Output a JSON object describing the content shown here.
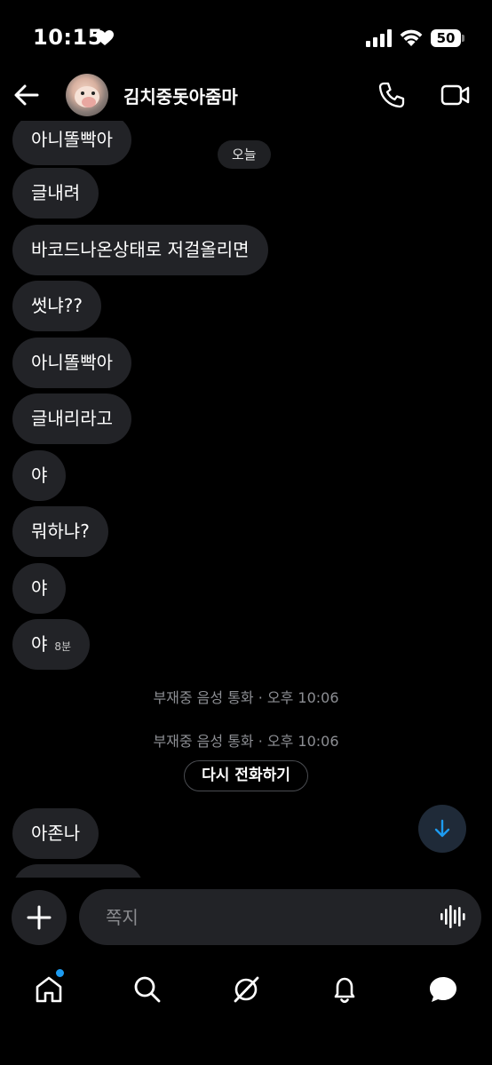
{
  "status_bar": {
    "time": "10:15",
    "battery": "50"
  },
  "header": {
    "contact_name": "김치중돗아줌마"
  },
  "messages": {
    "date_chip": "오늘",
    "bubbles": [
      {
        "text": "아니똘빡아",
        "time": ""
      },
      {
        "text": "글내려",
        "time": ""
      },
      {
        "text": "바코드나온상태로 저걸올리면",
        "time": ""
      },
      {
        "text": "썻냐??",
        "time": ""
      },
      {
        "text": "아니똘빡아",
        "time": ""
      },
      {
        "text": "글내리라고",
        "time": ""
      },
      {
        "text": "야",
        "time": ""
      },
      {
        "text": "뭐하냐?",
        "time": ""
      },
      {
        "text": "야",
        "time": ""
      },
      {
        "text": "야",
        "time": "8분"
      }
    ],
    "missed_calls": [
      "부재중 음성 통화 · 오후 10:06",
      "부재중 음성 통화 · 오후 10:06"
    ],
    "callback_label": "다시 전화하기",
    "after_bubbles": [
      {
        "text": "아존나"
      }
    ]
  },
  "composer": {
    "placeholder": "쪽지"
  },
  "nav": {
    "accent_color": "#1d9bf0",
    "items": [
      "home-icon",
      "search-icon",
      "grok-icon",
      "notifications-icon",
      "messages-icon"
    ]
  }
}
